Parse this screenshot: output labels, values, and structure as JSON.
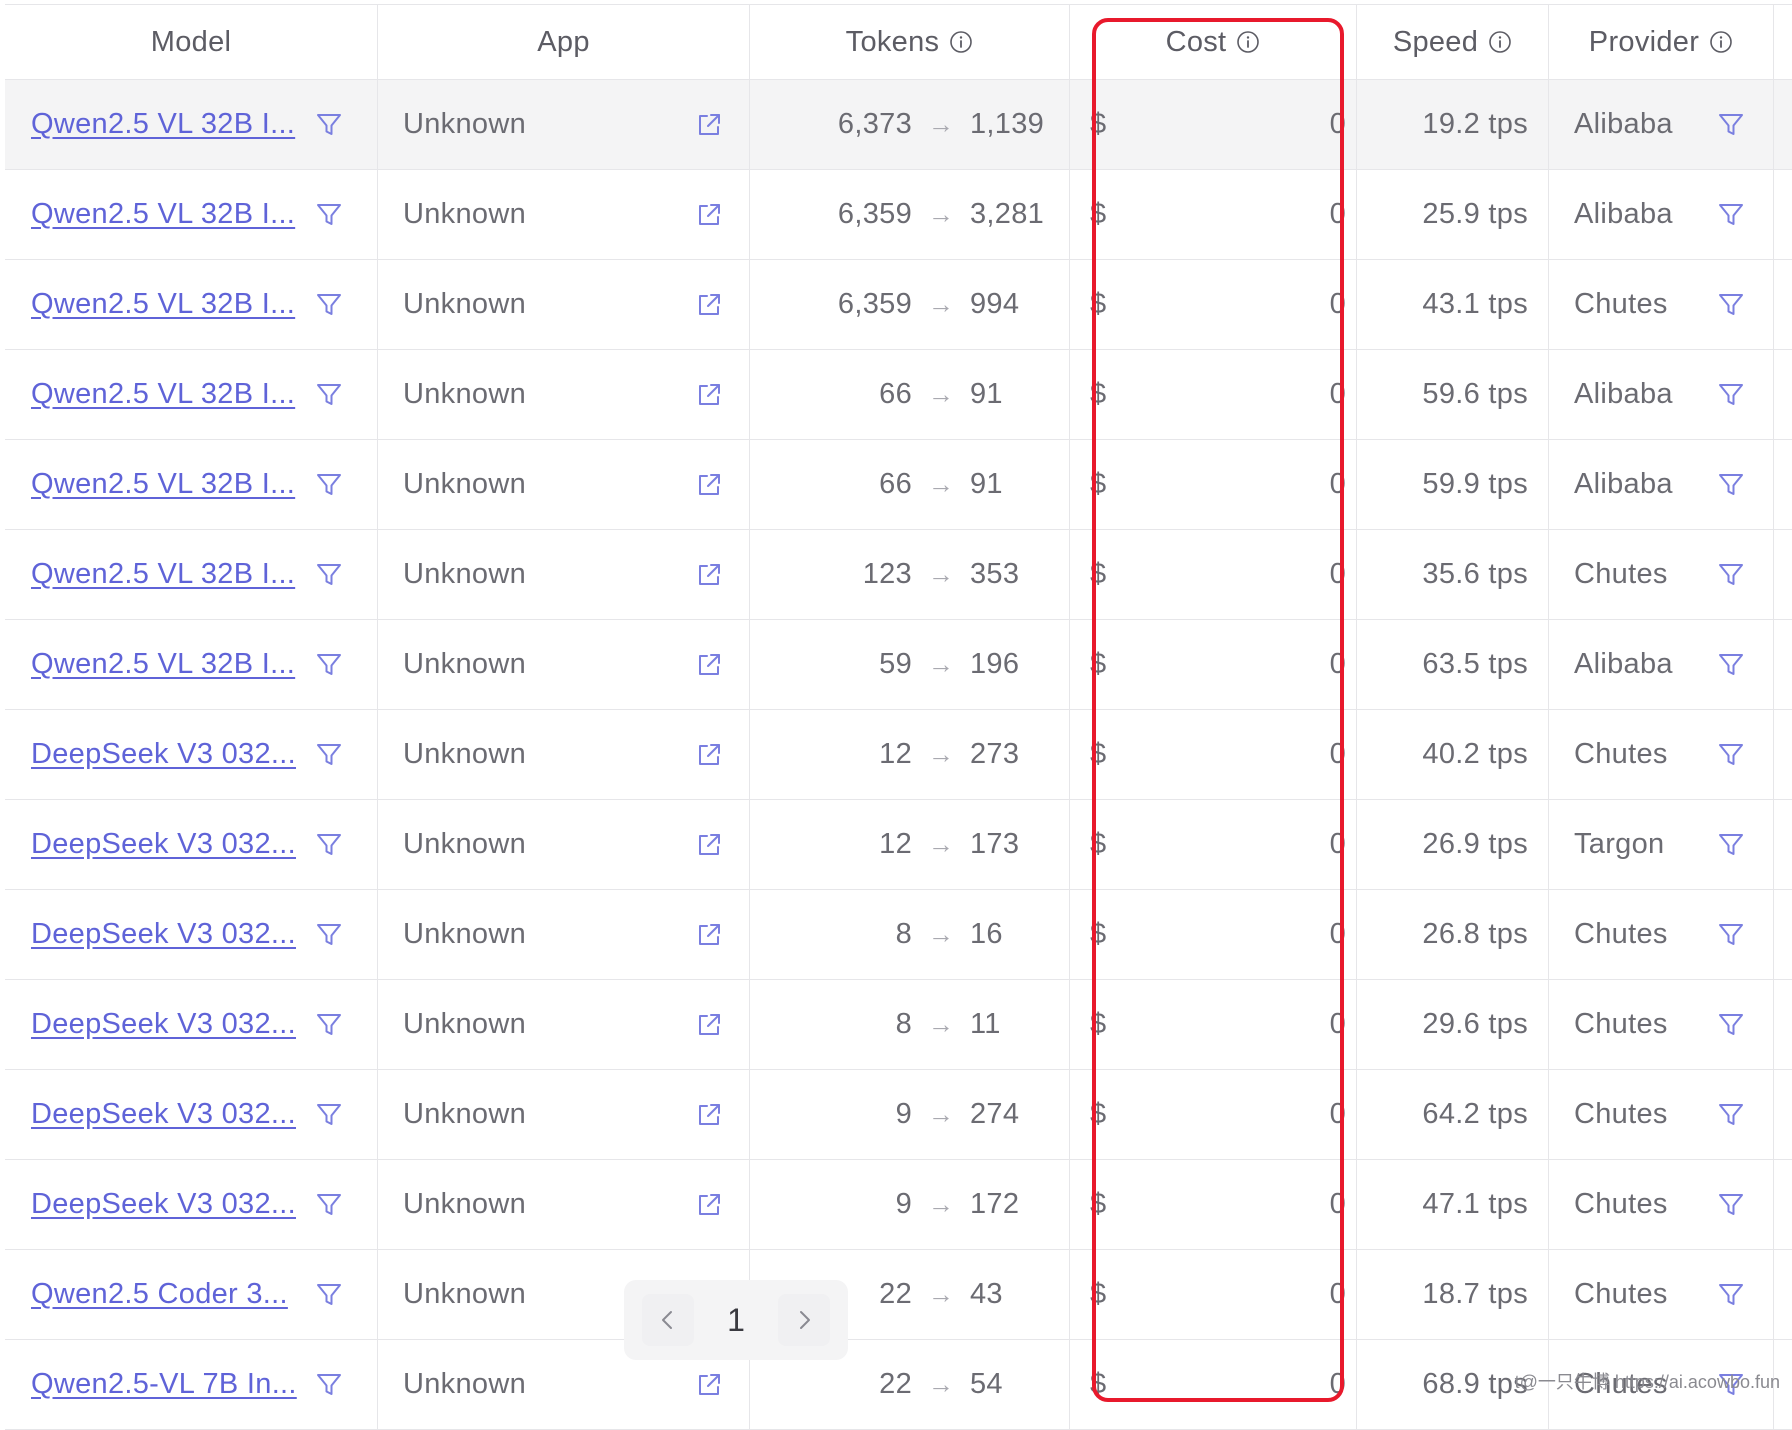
{
  "columns": {
    "model": "Model",
    "app": "App",
    "tokens": "Tokens",
    "cost": "Cost",
    "speed": "Speed",
    "provider": "Provider"
  },
  "rows": [
    {
      "model": "Qwen2.5 VL 32B I...",
      "app": "Unknown",
      "tokens_in": "6,373",
      "tokens_out": "1,139",
      "currency": "$",
      "cost": "0",
      "speed": "19.2 tps",
      "provider": "Alibaba"
    },
    {
      "model": "Qwen2.5 VL 32B I...",
      "app": "Unknown",
      "tokens_in": "6,359",
      "tokens_out": "3,281",
      "currency": "$",
      "cost": "0",
      "speed": "25.9 tps",
      "provider": "Alibaba"
    },
    {
      "model": "Qwen2.5 VL 32B I...",
      "app": "Unknown",
      "tokens_in": "6,359",
      "tokens_out": "994",
      "currency": "$",
      "cost": "0",
      "speed": "43.1 tps",
      "provider": "Chutes"
    },
    {
      "model": "Qwen2.5 VL 32B I...",
      "app": "Unknown",
      "tokens_in": "66",
      "tokens_out": "91",
      "currency": "$",
      "cost": "0",
      "speed": "59.6 tps",
      "provider": "Alibaba"
    },
    {
      "model": "Qwen2.5 VL 32B I...",
      "app": "Unknown",
      "tokens_in": "66",
      "tokens_out": "91",
      "currency": "$",
      "cost": "0",
      "speed": "59.9 tps",
      "provider": "Alibaba"
    },
    {
      "model": "Qwen2.5 VL 32B I...",
      "app": "Unknown",
      "tokens_in": "123",
      "tokens_out": "353",
      "currency": "$",
      "cost": "0",
      "speed": "35.6 tps",
      "provider": "Chutes"
    },
    {
      "model": "Qwen2.5 VL 32B I...",
      "app": "Unknown",
      "tokens_in": "59",
      "tokens_out": "196",
      "currency": "$",
      "cost": "0",
      "speed": "63.5 tps",
      "provider": "Alibaba"
    },
    {
      "model": "DeepSeek V3 032...",
      "app": "Unknown",
      "tokens_in": "12",
      "tokens_out": "273",
      "currency": "$",
      "cost": "0",
      "speed": "40.2 tps",
      "provider": "Chutes"
    },
    {
      "model": "DeepSeek V3 032...",
      "app": "Unknown",
      "tokens_in": "12",
      "tokens_out": "173",
      "currency": "$",
      "cost": "0",
      "speed": "26.9 tps",
      "provider": "Targon"
    },
    {
      "model": "DeepSeek V3 032...",
      "app": "Unknown",
      "tokens_in": "8",
      "tokens_out": "16",
      "currency": "$",
      "cost": "0",
      "speed": "26.8 tps",
      "provider": "Chutes"
    },
    {
      "model": "DeepSeek V3 032...",
      "app": "Unknown",
      "tokens_in": "8",
      "tokens_out": "11",
      "currency": "$",
      "cost": "0",
      "speed": "29.6 tps",
      "provider": "Chutes"
    },
    {
      "model": "DeepSeek V3 032...",
      "app": "Unknown",
      "tokens_in": "9",
      "tokens_out": "274",
      "currency": "$",
      "cost": "0",
      "speed": "64.2 tps",
      "provider": "Chutes"
    },
    {
      "model": "DeepSeek V3 032...",
      "app": "Unknown",
      "tokens_in": "9",
      "tokens_out": "172",
      "currency": "$",
      "cost": "0",
      "speed": "47.1 tps",
      "provider": "Chutes"
    },
    {
      "model": "Qwen2.5 Coder 3...",
      "app": "Unknown",
      "tokens_in": "22",
      "tokens_out": "43",
      "currency": "$",
      "cost": "0",
      "speed": "18.7 tps",
      "provider": "Chutes"
    },
    {
      "model": "Qwen2.5-VL 7B In...",
      "app": "Unknown",
      "tokens_in": "22",
      "tokens_out": "54",
      "currency": "$",
      "cost": "0",
      "speed": "68.9 tps",
      "provider": "Chutes"
    }
  ],
  "highlighted_row": 0,
  "arrow_glyph": "→",
  "pagination": {
    "current_page": "1",
    "prev_icon": "chevron-left-icon",
    "next_icon": "chevron-right-icon"
  },
  "icons": {
    "filter": "filter-icon",
    "external": "external-link-icon",
    "info": "info-icon"
  },
  "colors": {
    "link": "#5f63d8",
    "icon": "#7a7fe0",
    "highlight_border": "#e8192c",
    "row_highlight": "#f4f4f5"
  },
  "watermark": "t@一只牛博 https://ai.acowbo.fun"
}
